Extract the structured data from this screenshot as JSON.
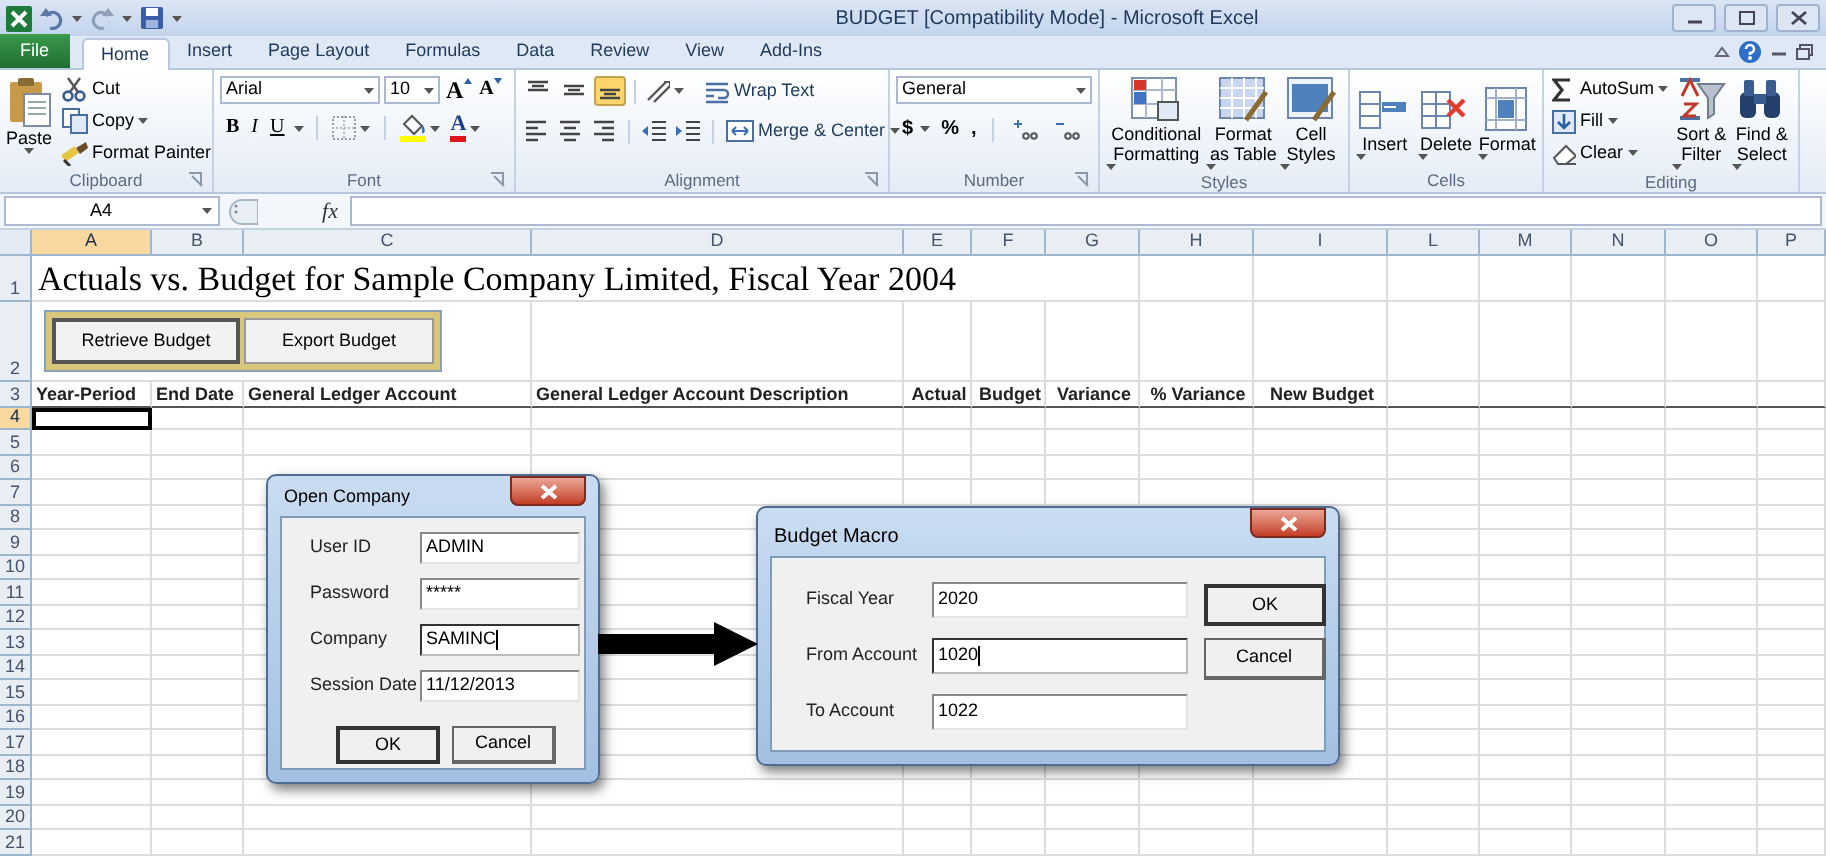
{
  "window": {
    "title": "BUDGET [Compatibility Mode] - Microsoft Excel"
  },
  "tabs": [
    {
      "label": "File",
      "kind": "file",
      "selected": false
    },
    {
      "label": "Home",
      "kind": "tab",
      "selected": true
    },
    {
      "label": "Insert",
      "kind": "tab",
      "selected": false
    },
    {
      "label": "Page Layout",
      "kind": "tab",
      "selected": false
    },
    {
      "label": "Formulas",
      "kind": "tab",
      "selected": false
    },
    {
      "label": "Data",
      "kind": "tab",
      "selected": false
    },
    {
      "label": "Review",
      "kind": "tab",
      "selected": false
    },
    {
      "label": "View",
      "kind": "tab",
      "selected": false
    },
    {
      "label": "Add-Ins",
      "kind": "tab",
      "selected": false
    }
  ],
  "ribbon": {
    "groups": [
      {
        "kind": "clipboard",
        "label": "Clipboard",
        "dialog_launcher": true,
        "paste": "Paste",
        "items": [
          "Cut",
          "Copy",
          "Format Painter"
        ]
      },
      {
        "kind": "font",
        "label": "Font",
        "dialog_launcher": true,
        "font_name": "Arial",
        "font_size": "10",
        "grow_shrink": [
          "A",
          "A"
        ],
        "styles": [
          "B",
          "I",
          "U"
        ],
        "font_color": "A"
      },
      {
        "kind": "alignment",
        "label": "Alignment",
        "dialog_launcher": true,
        "vertical_align": [
          {
            "selected": false
          },
          {
            "selected": false
          },
          {
            "selected": true
          }
        ],
        "wrap": "Wrap Text",
        "merge": "Merge & Center"
      },
      {
        "kind": "number",
        "label": "Number",
        "dialog_launcher": true,
        "format": "General",
        "symbols": [
          "$",
          "%",
          ","
        ]
      },
      {
        "kind": "styles",
        "label": "Styles",
        "dialog_launcher": false,
        "buttons": [
          {
            "lines": [
              "Conditional",
              "Formatting"
            ]
          },
          {
            "lines": [
              "Format",
              "as Table"
            ]
          },
          {
            "lines": [
              "Cell",
              "Styles"
            ]
          }
        ]
      },
      {
        "kind": "cells",
        "label": "Cells",
        "dialog_launcher": false,
        "buttons": [
          "Insert",
          "Delete",
          "Format"
        ]
      },
      {
        "kind": "editing",
        "label": "Editing",
        "dialog_launcher": false,
        "items": [
          "AutoSum",
          "Fill",
          "Clear"
        ],
        "buttons": [
          {
            "lines": [
              "Sort &",
              "Filter"
            ]
          },
          {
            "lines": [
              "Find &",
              "Select"
            ]
          }
        ]
      }
    ]
  },
  "formula_bar": {
    "name_box": "A4",
    "function_label": "fx"
  },
  "sheet": {
    "columns": [
      {
        "label": "A",
        "selected": true
      },
      {
        "label": "B",
        "selected": false
      },
      {
        "label": "C",
        "selected": false
      },
      {
        "label": "D",
        "selected": false
      },
      {
        "label": "E",
        "selected": false
      },
      {
        "label": "F",
        "selected": false
      },
      {
        "label": "G",
        "selected": false
      },
      {
        "label": "H",
        "selected": false
      },
      {
        "label": "I",
        "selected": false
      },
      {
        "label": "L",
        "selected": false
      },
      {
        "label": "M",
        "selected": false
      },
      {
        "label": "N",
        "selected": false
      },
      {
        "label": "O",
        "selected": false
      },
      {
        "label": "P",
        "selected": false
      }
    ],
    "rows": [
      {
        "label": "1",
        "selected": false
      },
      {
        "label": "2",
        "selected": false
      },
      {
        "label": "3",
        "selected": false
      },
      {
        "label": "4",
        "selected": true
      },
      {
        "label": "5",
        "selected": false
      },
      {
        "label": "6",
        "selected": false
      },
      {
        "label": "7",
        "selected": false
      },
      {
        "label": "8",
        "selected": false
      },
      {
        "label": "9",
        "selected": false
      },
      {
        "label": "10",
        "selected": false
      },
      {
        "label": "11",
        "selected": false
      },
      {
        "label": "12",
        "selected": false
      },
      {
        "label": "13",
        "selected": false
      },
      {
        "label": "14",
        "selected": false
      },
      {
        "label": "15",
        "selected": false
      },
      {
        "label": "16",
        "selected": false
      },
      {
        "label": "17",
        "selected": false
      },
      {
        "label": "18",
        "selected": false
      },
      {
        "label": "19",
        "selected": false
      },
      {
        "label": "20",
        "selected": false
      },
      {
        "label": "21",
        "selected": false
      }
    ],
    "title": "Actuals vs. Budget for Sample Company Limited, Fiscal Year 2004",
    "macro_buttons": [
      {
        "label": "Retrieve Budget",
        "focused": true
      },
      {
        "label": "Export Budget",
        "focused": false
      }
    ],
    "headers": [
      "Year-Period",
      "End Date",
      "General Ledger Account",
      "General Ledger Account Description",
      "Actual",
      "Budget",
      "Variance",
      "% Variance",
      "New Budget"
    ]
  },
  "dialogs": [
    {
      "kind": "login",
      "title": "Open Company",
      "fields": [
        {
          "label": "User ID",
          "value": "ADMIN",
          "focused": false
        },
        {
          "label": "Password",
          "value": "*****",
          "focused": false
        },
        {
          "label": "Company",
          "value": "SAMINC",
          "focused": true
        },
        {
          "label": "Session Date",
          "value": "11/12/2013",
          "focused": false
        }
      ],
      "buttons": [
        {
          "label": "OK",
          "default": true
        },
        {
          "label": "Cancel",
          "default": false
        }
      ]
    },
    {
      "kind": "macro",
      "title": "Budget Macro",
      "fields": [
        {
          "label": "Fiscal Year",
          "value": "2020",
          "focused": false
        },
        {
          "label": "From Account",
          "value": "1020",
          "focused": true
        },
        {
          "label": "To Account",
          "value": "1022",
          "focused": false
        }
      ],
      "buttons": [
        {
          "label": "OK",
          "default": true
        },
        {
          "label": "Cancel",
          "default": false
        }
      ]
    }
  ]
}
